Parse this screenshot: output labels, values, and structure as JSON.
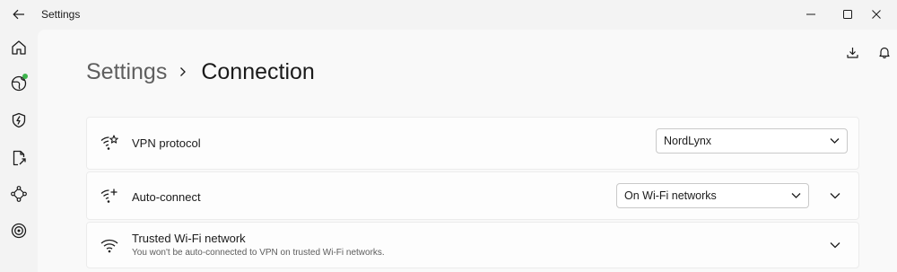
{
  "window": {
    "title": "Settings",
    "back_icon": "arrow-left-icon",
    "controls": [
      "minimize-icon",
      "maximize-icon",
      "close-icon"
    ]
  },
  "rail": {
    "items": [
      {
        "icon": "home-icon"
      },
      {
        "icon": "globe-icon",
        "status_color": "#3cb44b"
      },
      {
        "icon": "shield-bolt-icon"
      },
      {
        "icon": "file-export-icon"
      },
      {
        "icon": "nodes-icon"
      },
      {
        "icon": "target-icon"
      }
    ]
  },
  "toolbar": {
    "download_icon": "download-icon",
    "notifications_icon": "bell-icon"
  },
  "breadcrumb": {
    "parent": "Settings",
    "current": "Connection"
  },
  "settings": {
    "vpn_protocol": {
      "label": "VPN protocol",
      "icon": "wifi-star-icon",
      "value": "NordLynx"
    },
    "auto_connect": {
      "label": "Auto-connect",
      "icon": "wifi-plus-icon",
      "value": "On Wi-Fi networks"
    },
    "trusted_wifi": {
      "label": "Trusted Wi-Fi network",
      "icon": "wifi-icon",
      "description": "You won't be auto-connected to VPN on trusted Wi-Fi networks."
    }
  },
  "colors": {
    "accent_status": "#3cb44b",
    "background": "#f3f3f3",
    "surface": "#f9f9f9"
  }
}
